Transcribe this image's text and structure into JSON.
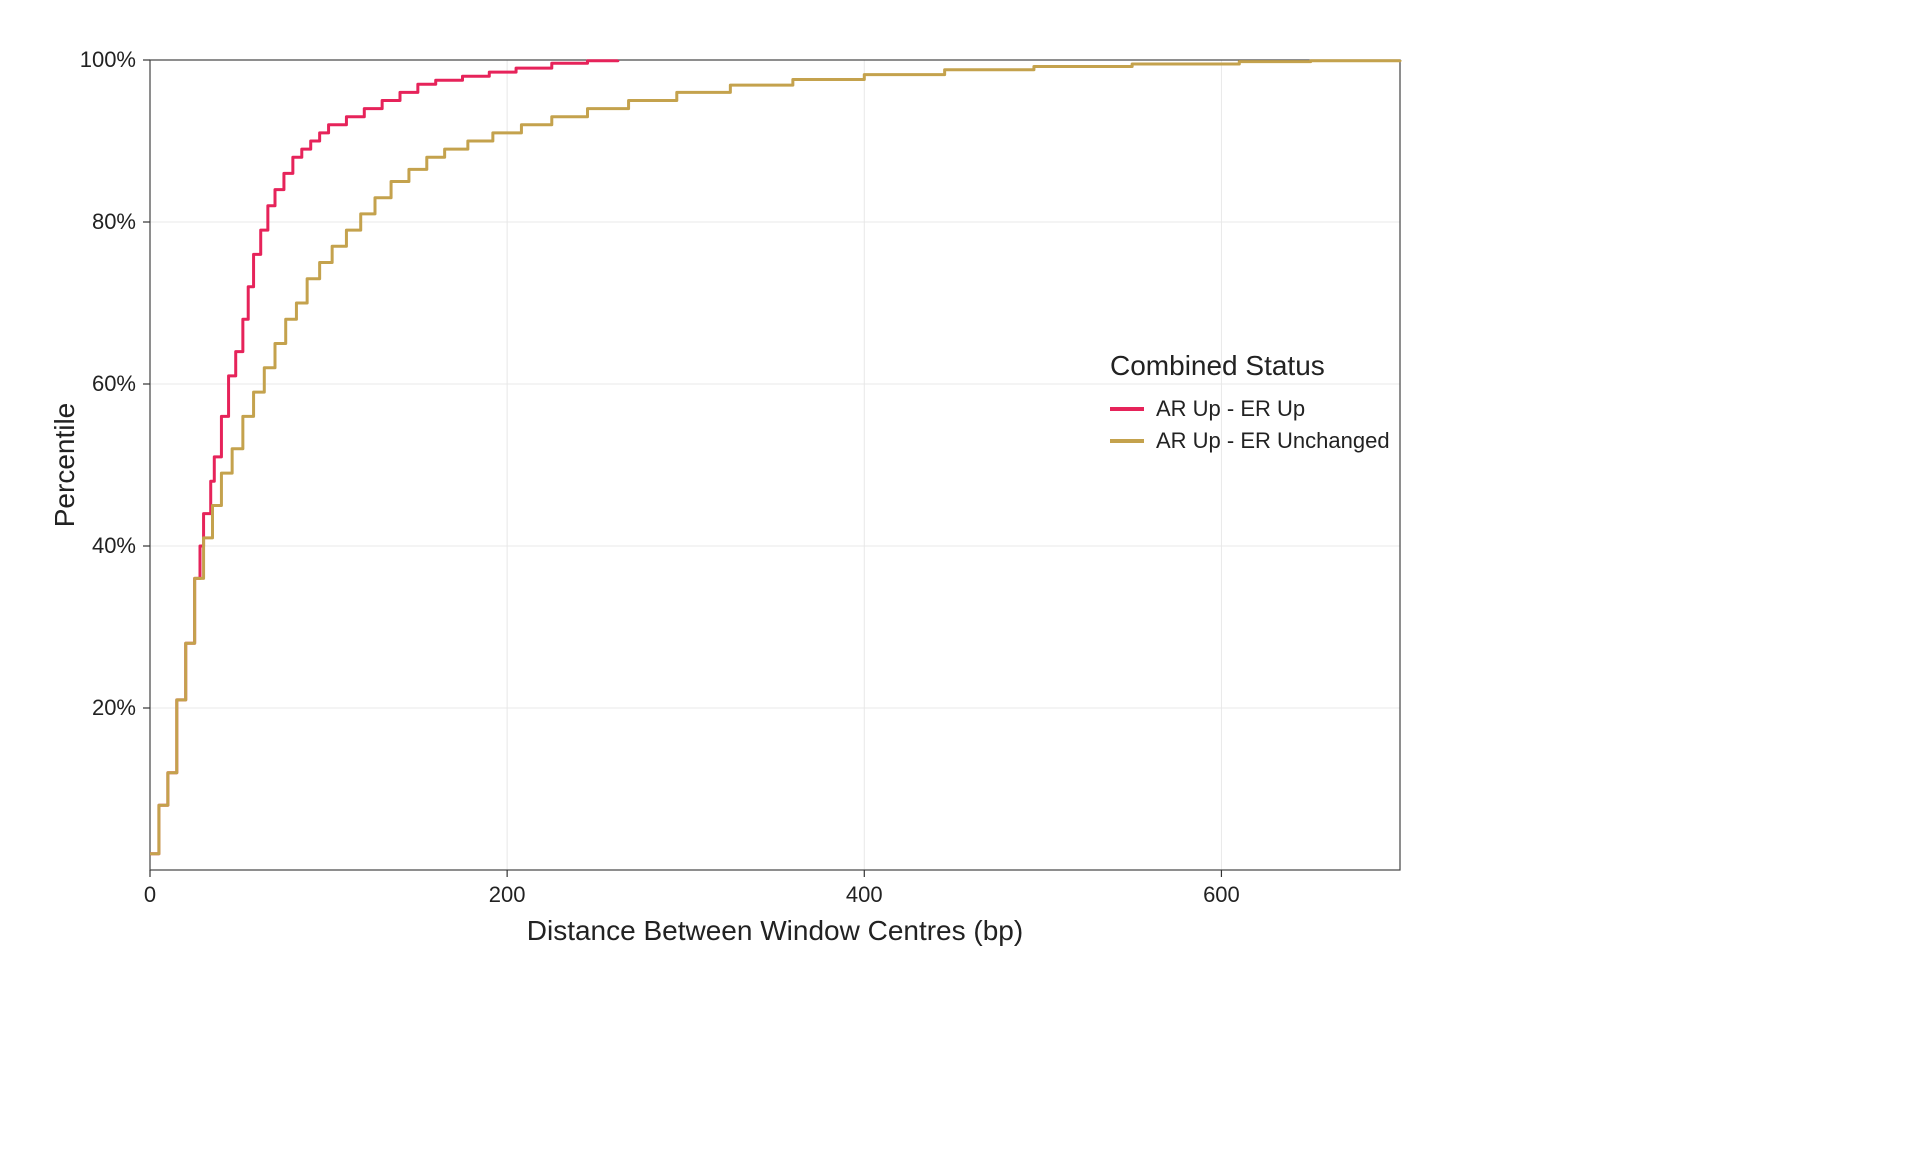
{
  "chart_data": {
    "type": "line",
    "xlabel": "Distance Between Window Centres (bp)",
    "ylabel": "Percentile",
    "xlim": [
      0,
      700
    ],
    "ylim": [
      0,
      100
    ],
    "x_ticks": [
      0,
      200,
      400,
      600
    ],
    "y_ticks": [
      20,
      40,
      60,
      80,
      100
    ],
    "y_tick_format_suffix": "%",
    "legend_title": "Combined Status",
    "series": [
      {
        "name": "AR Up - ER Up",
        "color": "#e6235a",
        "points": [
          [
            0,
            2
          ],
          [
            5,
            8
          ],
          [
            10,
            12
          ],
          [
            15,
            21
          ],
          [
            20,
            28
          ],
          [
            25,
            36
          ],
          [
            28,
            40
          ],
          [
            30,
            44
          ],
          [
            34,
            48
          ],
          [
            36,
            51
          ],
          [
            40,
            56
          ],
          [
            44,
            61
          ],
          [
            48,
            64
          ],
          [
            52,
            68
          ],
          [
            55,
            72
          ],
          [
            58,
            76
          ],
          [
            62,
            79
          ],
          [
            66,
            82
          ],
          [
            70,
            84
          ],
          [
            75,
            86
          ],
          [
            80,
            88
          ],
          [
            85,
            89
          ],
          [
            90,
            90
          ],
          [
            95,
            91
          ],
          [
            100,
            92
          ],
          [
            110,
            93
          ],
          [
            120,
            94
          ],
          [
            130,
            95
          ],
          [
            140,
            96
          ],
          [
            150,
            97
          ],
          [
            160,
            97.5
          ],
          [
            175,
            98
          ],
          [
            190,
            98.5
          ],
          [
            205,
            99
          ],
          [
            225,
            99.6
          ],
          [
            245,
            99.9
          ],
          [
            262,
            100
          ]
        ]
      },
      {
        "name": "AR Up - ER Unchanged",
        "color": "#c4a24d",
        "points": [
          [
            0,
            2
          ],
          [
            5,
            8
          ],
          [
            10,
            12
          ],
          [
            15,
            21
          ],
          [
            20,
            28
          ],
          [
            25,
            36
          ],
          [
            30,
            41
          ],
          [
            35,
            45
          ],
          [
            40,
            49
          ],
          [
            46,
            52
          ],
          [
            52,
            56
          ],
          [
            58,
            59
          ],
          [
            64,
            62
          ],
          [
            70,
            65
          ],
          [
            76,
            68
          ],
          [
            82,
            70
          ],
          [
            88,
            73
          ],
          [
            95,
            75
          ],
          [
            102,
            77
          ],
          [
            110,
            79
          ],
          [
            118,
            81
          ],
          [
            126,
            83
          ],
          [
            135,
            85
          ],
          [
            145,
            86.5
          ],
          [
            155,
            88
          ],
          [
            165,
            89
          ],
          [
            178,
            90
          ],
          [
            192,
            91
          ],
          [
            208,
            92
          ],
          [
            225,
            93
          ],
          [
            245,
            94
          ],
          [
            268,
            95
          ],
          [
            295,
            96
          ],
          [
            325,
            96.9
          ],
          [
            360,
            97.6
          ],
          [
            400,
            98.2
          ],
          [
            445,
            98.8
          ],
          [
            495,
            99.2
          ],
          [
            550,
            99.5
          ],
          [
            610,
            99.8
          ],
          [
            650,
            99.9
          ],
          [
            700,
            100
          ]
        ]
      }
    ]
  }
}
